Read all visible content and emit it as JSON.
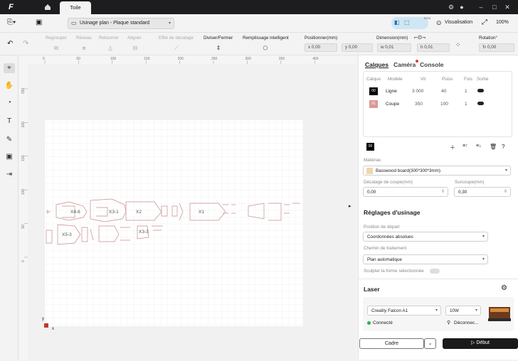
{
  "titlebar": {
    "logo": "F",
    "tab": "Toile"
  },
  "toolbar": {
    "mode_select": "Usinage plan - Plaque standard",
    "preview_label": "Visualisation",
    "beta": "Beta",
    "zoom": "100%"
  },
  "tools": {
    "regrouper": "Regrouper",
    "reseau": "Réseau",
    "retourner": "Retourner",
    "aligner": "Aligner",
    "effet": "Effet de décalage",
    "diviser": "Diviser/Fermer",
    "remplissage": "Remplissage intelligent",
    "positionner": "Positionner(mm)",
    "dimension": "Dimension(mm)",
    "rotation": "Rotation°",
    "x": "x 0,00",
    "y": "y 0,00",
    "w": "w 0,01",
    "h": "h 0,01",
    "rot": "0,00"
  },
  "ruler": {
    "h": [
      "0",
      "50",
      "100",
      "150",
      "200",
      "250",
      "300",
      "350",
      "400"
    ],
    "v": [
      "250",
      "200",
      "150",
      "100",
      "50",
      "0"
    ]
  },
  "canvas": {
    "labels": [
      "X4-8",
      "X3-1",
      "X2",
      "X1",
      "X5-3",
      "X3-3"
    ],
    "axis_x": "x",
    "axis_y": "y"
  },
  "panel": {
    "tab_layers": "Calques",
    "tab_camera": "Caméra",
    "tab_console": "Console",
    "headers": [
      "Calque",
      "Modèle",
      "Vit",
      "Puiss",
      "Fois",
      "Sortie"
    ],
    "layers": [
      {
        "id": "00",
        "mode": "Ligne",
        "speed": "3 000",
        "power": "40",
        "passes": "1",
        "color": "#000000"
      },
      {
        "id": "01",
        "mode": "Coupe",
        "speed": "350",
        "power": "100",
        "passes": "1",
        "color": "#d99a9a"
      }
    ],
    "selected_layer": "00",
    "material_label": "Matériau",
    "material": "Basswood board(300*300*3mm)",
    "offset_label": "Décalage de coupe(mm)",
    "offset": "0,00",
    "overcut_label": "Surcoupe(mm)",
    "overcut": "0,30",
    "machining_title": "Réglages d'usinage",
    "start_label": "Position de départ",
    "start": "Coordonnées absolues",
    "path_label": "Chemin de traitement",
    "path": "Plan automatique",
    "sculpt_label": "Sculpter la forme sélectionnée",
    "laser_title": "Laser",
    "device": "Creality Falcon A1",
    "power": "10W",
    "connected": "Connecté",
    "disconnect": "Déconnec...",
    "frame_button": "Cadre",
    "start_button": "Début"
  },
  "colors": {
    "accent": "#1a1a1a",
    "path": "#c98c8c",
    "connected": "#2bb24c"
  }
}
